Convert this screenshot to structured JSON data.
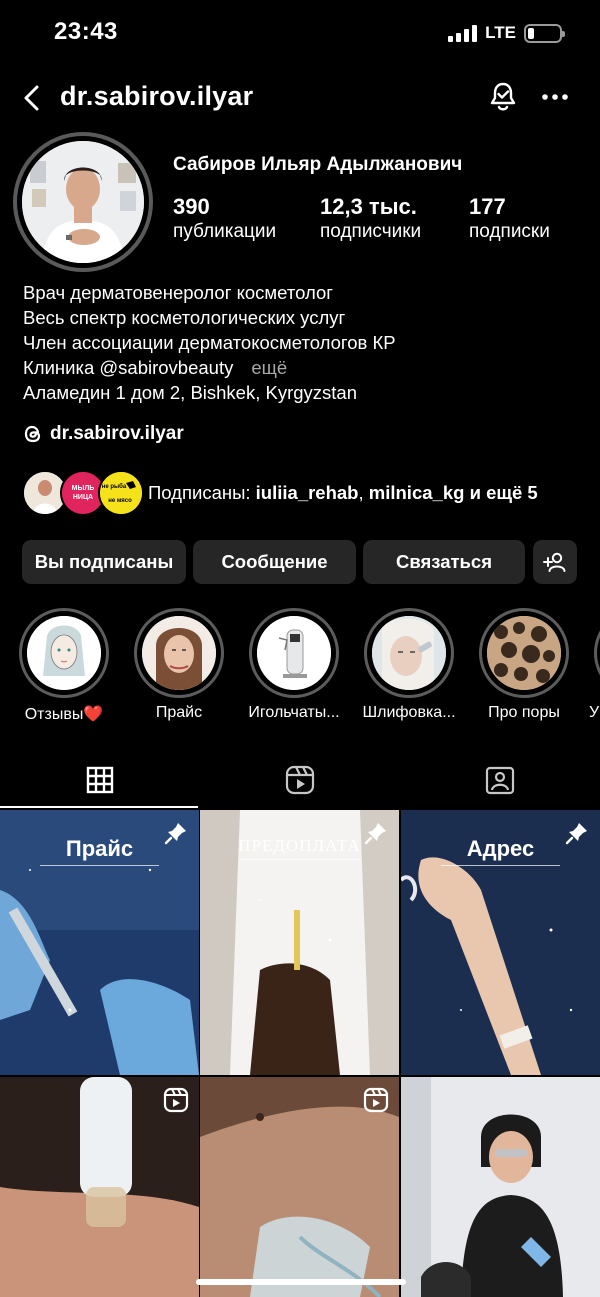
{
  "status": {
    "time": "23:43",
    "network": "LTE",
    "battery_level": 0.2
  },
  "header": {
    "username": "dr.sabirov.ilyar"
  },
  "profile": {
    "full_name": "Сабиров Ильяр Адылжанович",
    "stats": [
      {
        "value": "390",
        "label": "публикации"
      },
      {
        "value": "12,3 тыс.",
        "label": "подписчики"
      },
      {
        "value": "177",
        "label": "подписки"
      }
    ],
    "bio": [
      "Врач дерматовенеролог косметолог",
      "Весь спектр косметологических услуг",
      "Член ассоциации дерматокосметологов КР",
      "Клиника @sabirovbeauty"
    ],
    "bio_more": "ещё",
    "location": "Аламедин 1 дом 2, Bishkek, Kyrgyzstan",
    "threads_handle": "dr.sabirov.ilyar",
    "followed_by": {
      "prefix": "Подписаны:",
      "user1": "iuliia_rehab",
      "separator": ",",
      "user2": "milnica_kg",
      "suffix": "и ещё 5"
    }
  },
  "actions": {
    "following": "Вы подписаны",
    "message": "Сообщение",
    "contact": "Связаться"
  },
  "highlights": [
    {
      "label": "Отзывы❤️"
    },
    {
      "label": "Прайс"
    },
    {
      "label": "Игольчаты..."
    },
    {
      "label": "Шлифовка..."
    },
    {
      "label": "Про поры"
    },
    {
      "label": "У"
    }
  ],
  "grid": [
    {
      "title": "Прайс",
      "badge": "pin-icon"
    },
    {
      "title": "ПРЕДОПЛАТА",
      "badge": "pin-icon"
    },
    {
      "title": "Адрес",
      "badge": "pin-icon"
    },
    {
      "title": "",
      "badge": "reel-icon"
    },
    {
      "title": "",
      "badge": "reel-icon"
    },
    {
      "title": "",
      "badge": ""
    }
  ],
  "mini_avatar_texts": {
    "second": "МЫЛЬ НИЦА",
    "third": "не рыба не мясо"
  },
  "colors": {
    "background": "#000000",
    "button": "#262626",
    "secondary_text": "#a8a8a8"
  }
}
